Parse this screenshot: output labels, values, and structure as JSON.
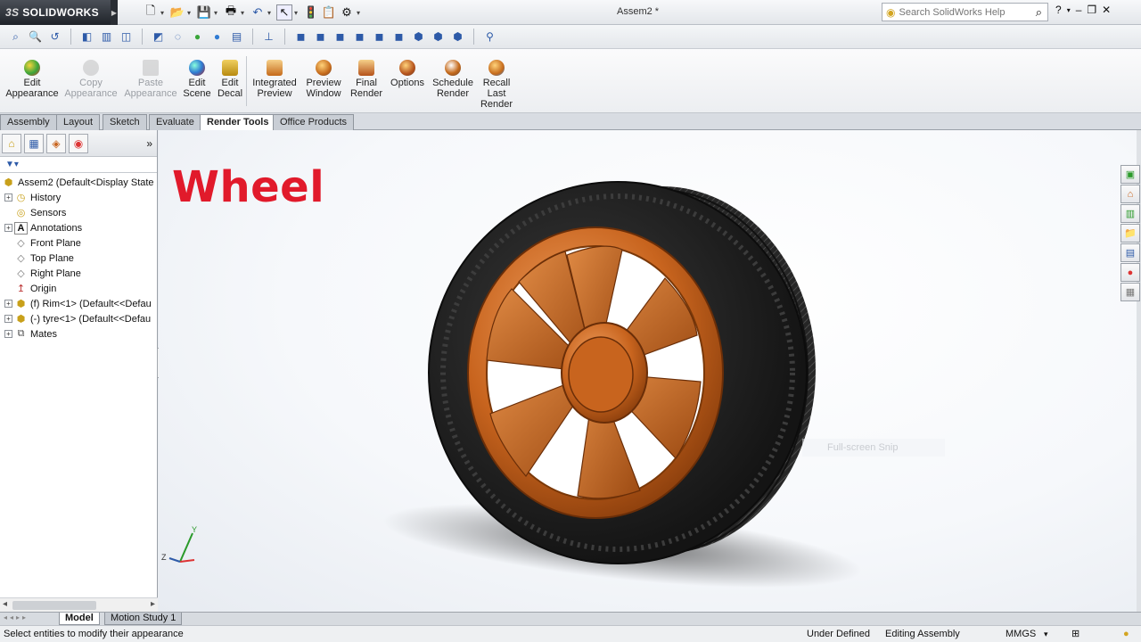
{
  "app": {
    "name": "SOLIDWORKS",
    "logo_mark": "3S",
    "document_title": "Assem2 *"
  },
  "search": {
    "placeholder": "Search SolidWorks Help"
  },
  "ribbon": {
    "commands": [
      {
        "line1": "Edit",
        "line2": "Appearance",
        "line3": "",
        "enabled": true,
        "color": "#3aa53a"
      },
      {
        "line1": "Copy",
        "line2": "Appearance",
        "line3": "",
        "enabled": false,
        "color": "#999999"
      },
      {
        "line1": "Paste",
        "line2": "Appearance",
        "line3": "",
        "enabled": false,
        "color": "#999999"
      },
      {
        "line1": "Edit",
        "line2": "Scene",
        "line3": "",
        "enabled": true,
        "color": "#2f7bd3"
      },
      {
        "line1": "Edit",
        "line2": "Decal",
        "line3": "",
        "enabled": true,
        "color": "#d4a01a"
      },
      {
        "line1": "Integrated",
        "line2": "Preview",
        "line3": "",
        "enabled": true,
        "color": "#cc6a1a"
      },
      {
        "line1": "Preview",
        "line2": "Window",
        "line3": "",
        "enabled": true,
        "color": "#cc6a1a"
      },
      {
        "line1": "Final",
        "line2": "Render",
        "line3": "",
        "enabled": true,
        "color": "#cc6a1a"
      },
      {
        "line1": "Options",
        "line2": "",
        "line3": "",
        "enabled": true,
        "color": "#cc6a1a"
      },
      {
        "line1": "Schedule",
        "line2": "Render",
        "line3": "",
        "enabled": true,
        "color": "#cc6a1a"
      },
      {
        "line1": "Recall",
        "line2": "Last",
        "line3": "Render",
        "enabled": true,
        "color": "#cc6a1a"
      }
    ]
  },
  "tabs": [
    "Assembly",
    "Layout",
    "Sketch",
    "Evaluate",
    "Render Tools",
    "Office Products"
  ],
  "active_tab": "Render Tools",
  "tree": {
    "root": "Assem2  (Default<Display State",
    "items": [
      {
        "label": "History",
        "expandable": true,
        "icon": "history-icon"
      },
      {
        "label": "Sensors",
        "expandable": false,
        "icon": "sensors-icon"
      },
      {
        "label": "Annotations",
        "expandable": true,
        "icon": "annotations-icon"
      },
      {
        "label": "Front Plane",
        "expandable": false,
        "icon": "plane-icon"
      },
      {
        "label": "Top Plane",
        "expandable": false,
        "icon": "plane-icon"
      },
      {
        "label": "Right Plane",
        "expandable": false,
        "icon": "plane-icon"
      },
      {
        "label": "Origin",
        "expandable": false,
        "icon": "origin-icon"
      },
      {
        "label": "(f) Rim<1> (Default<<Defau",
        "expandable": true,
        "icon": "part-icon"
      },
      {
        "label": "(-) tyre<1> (Default<<Defau",
        "expandable": true,
        "icon": "part-icon"
      },
      {
        "label": "Mates",
        "expandable": true,
        "icon": "mates-icon"
      }
    ]
  },
  "graphics": {
    "overlay_title": "Wheel",
    "snip_label": "Full-screen Snip",
    "triad": {
      "x": "X",
      "y": "Y",
      "z": "Z"
    },
    "colors": {
      "rim": "#c8641e",
      "tire": "#2a2a2a",
      "title": "#e11a2b"
    }
  },
  "bottom_tabs": [
    "Model",
    "Motion Study 1"
  ],
  "status": {
    "message": "Select entities to modify their appearance",
    "state": "Under Defined",
    "mode": "Editing Assembly",
    "units": "MMGS"
  }
}
